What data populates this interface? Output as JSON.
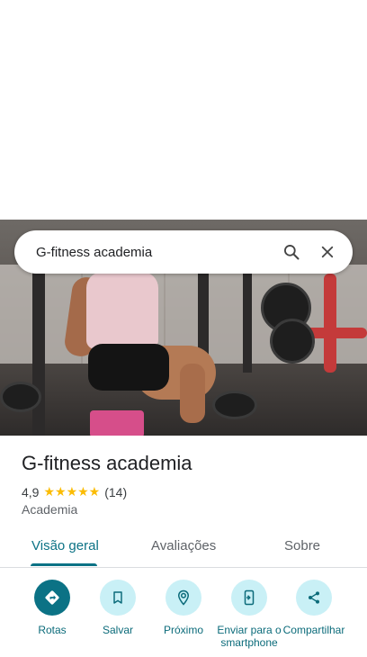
{
  "search": {
    "query": "G-fitness academia"
  },
  "place": {
    "name": "G-fitness academia",
    "rating": "4,9",
    "stars": "★★★★★",
    "review_count": "(14)",
    "category": "Academia"
  },
  "tabs": [
    {
      "label": "Visão geral",
      "active": true
    },
    {
      "label": "Avaliações",
      "active": false
    },
    {
      "label": "Sobre",
      "active": false
    }
  ],
  "actions": [
    {
      "label": "Rotas",
      "icon": "directions-icon"
    },
    {
      "label": "Salvar",
      "icon": "bookmark-icon"
    },
    {
      "label": "Próximo",
      "icon": "nearby-icon"
    },
    {
      "label": "Enviar para o smartphone",
      "icon": "send-to-phone-icon"
    },
    {
      "label": "Compartilhar",
      "icon": "share-icon"
    }
  ],
  "colors": {
    "accent": "#0b7285",
    "action_bg": "#c9f0f6",
    "star": "#fbbc04"
  }
}
